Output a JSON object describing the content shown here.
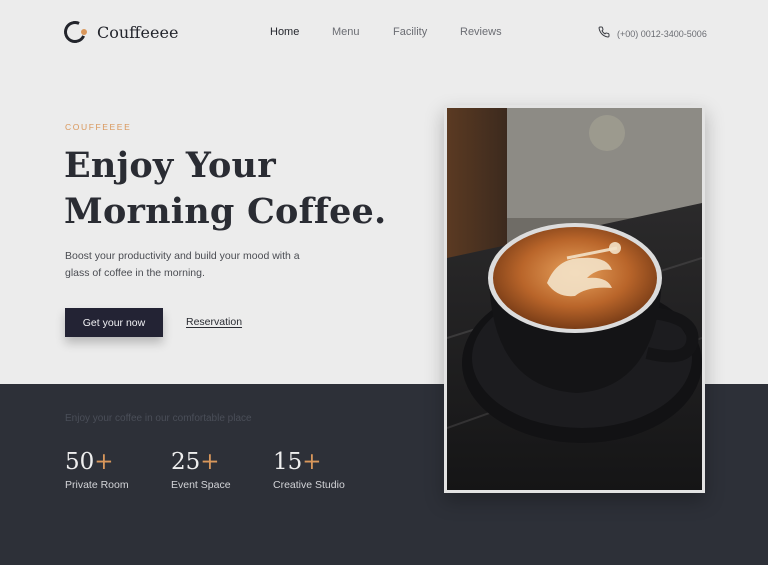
{
  "brand": {
    "name": "Couffeeee",
    "logo_icon": "coffee-c-logo-icon"
  },
  "nav": {
    "items": [
      {
        "label": "Home",
        "active": true
      },
      {
        "label": "Menu",
        "active": false
      },
      {
        "label": "Facility",
        "active": false
      },
      {
        "label": "Reviews",
        "active": false
      }
    ]
  },
  "contact": {
    "phone": "(+00) 0012-3400-5006",
    "icon": "phone-icon"
  },
  "hero": {
    "eyebrow": "COUFFEEEE",
    "headline_line1": "Enjoy Your",
    "headline_line2": "Morning Coffee.",
    "subtext": "Boost your productivity and build your mood with a glass of coffee in the morning.",
    "primary_button": "Get your now",
    "secondary_link": "Reservation"
  },
  "facility": {
    "caption": "Enjoy your coffee in our comfortable place",
    "stats": [
      {
        "number": "50",
        "suffix": "+",
        "label": "Private Room"
      },
      {
        "number": "25",
        "suffix": "+",
        "label": "Event Space"
      },
      {
        "number": "15",
        "suffix": "+",
        "label": "Creative Studio"
      }
    ]
  },
  "colors": {
    "accent": "#d9975b",
    "dark_band": "#2d3038",
    "button": "#232334",
    "background": "#ececec"
  }
}
